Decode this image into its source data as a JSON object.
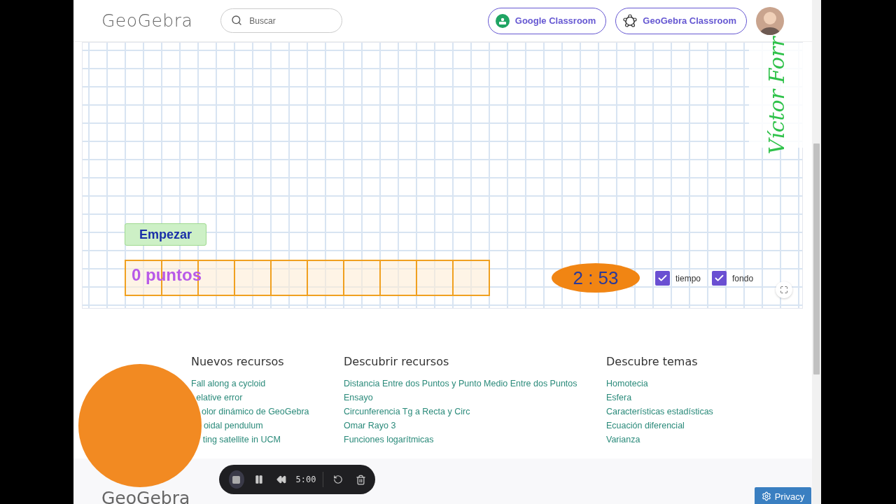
{
  "header": {
    "logo": "GeoGebra",
    "search": {
      "placeholder": "Buscar"
    },
    "buttons": [
      {
        "kind": "google",
        "label": "Google Classroom"
      },
      {
        "kind": "geogebra",
        "label": "GeoGebra Classroom"
      }
    ]
  },
  "applet": {
    "signature": "Víctor Forr",
    "start_button": "Empezar",
    "score": "0 puntos",
    "timer": "2 : 53",
    "checkboxes": [
      {
        "label": "tiempo",
        "checked": true
      },
      {
        "label": "fondo",
        "checked": true
      }
    ]
  },
  "footer": {
    "columns": [
      {
        "heading": "Nuevos recursos",
        "links": [
          "Fall along a cycloid",
          "elative error",
          "olor dinámico de GeoGebra",
          "oidal pendulum",
          "ting satellite in UCM"
        ]
      },
      {
        "heading": "Descubrir recursos",
        "links": [
          "Distancia Entre dos Puntos y Punto Medio Entre dos Puntos",
          "Ensayo",
          "Circunferencia Tg a Recta y Circ",
          "Omar Rayo 3",
          "Funciones logarítmicas"
        ]
      },
      {
        "heading": "Descubre temas",
        "links": [
          "Homotecia",
          "Esfera",
          "Características estadísticas",
          "Ecuación diferencial",
          "Varianza"
        ]
      }
    ],
    "logo": "GeoGebra"
  },
  "recorder": {
    "time": "5:00"
  },
  "privacy_button": "Privacy"
}
